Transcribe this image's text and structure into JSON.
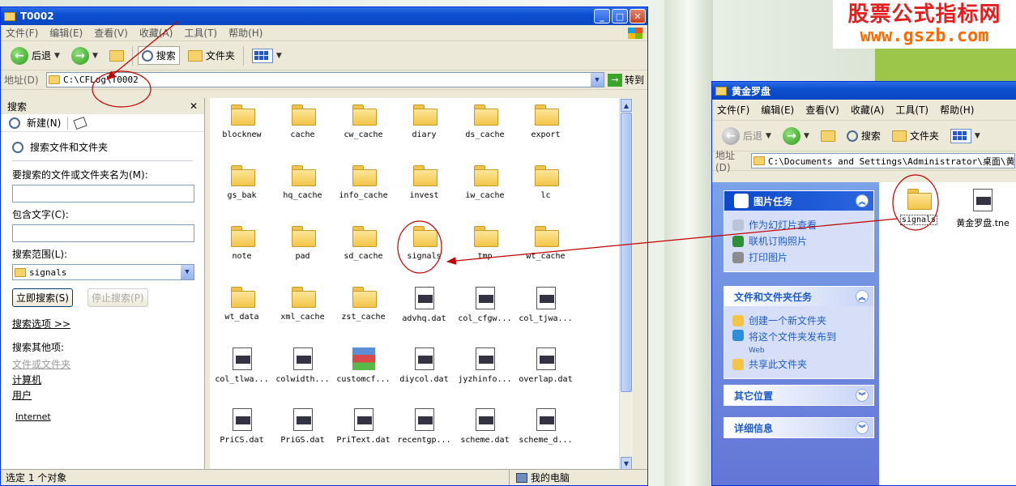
{
  "colors": {
    "title_blue": "#0c4fd0",
    "task_blue": "#6375d6",
    "annotation_red": "#c00000",
    "brand_red": "#e02020",
    "brand_orange": "#ff6a00"
  },
  "brand": {
    "line1": "股票公式指标网",
    "line2": "www.gszb.com"
  },
  "w1": {
    "title": "T0002",
    "menu": [
      "文件(F)",
      "编辑(E)",
      "查看(V)",
      "收藏(A)",
      "工具(T)",
      "帮助(H)"
    ],
    "toolbar": {
      "back": "后退",
      "search": "搜索",
      "folders": "文件夹"
    },
    "address": {
      "label": "地址(D)",
      "value": "C:\\CFLog\\T0002",
      "go": "转到"
    },
    "search_pane": {
      "title": "搜索",
      "new": "新建(N)",
      "heading": "搜索文件和文件夹",
      "name_label": "要搜索的文件或文件夹名为(M):",
      "contains_label": "包含文字(C):",
      "scope_label": "搜索范围(L):",
      "scope_value": "signals",
      "start": "立即搜索(S)",
      "stop": "停止搜索(P)",
      "options": "搜索选项 >>",
      "other": "搜索其他项:",
      "other_items": [
        "文件或文件夹",
        "计算机",
        "用户"
      ],
      "internet": "Internet"
    },
    "items": [
      {
        "name": "blocknew",
        "type": "folder"
      },
      {
        "name": "cache",
        "type": "folder"
      },
      {
        "name": "cw_cache",
        "type": "folder"
      },
      {
        "name": "diary",
        "type": "folder"
      },
      {
        "name": "ds_cache",
        "type": "folder"
      },
      {
        "name": "export",
        "type": "folder"
      },
      {
        "name": "gs_bak",
        "type": "folder"
      },
      {
        "name": "hq_cache",
        "type": "folder"
      },
      {
        "name": "info_cache",
        "type": "folder"
      },
      {
        "name": "invest",
        "type": "folder"
      },
      {
        "name": "iw_cache",
        "type": "folder"
      },
      {
        "name": "lc",
        "type": "folder"
      },
      {
        "name": "note",
        "type": "folder"
      },
      {
        "name": "pad",
        "type": "folder"
      },
      {
        "name": "sd_cache",
        "type": "folder"
      },
      {
        "name": "signals",
        "type": "folder"
      },
      {
        "name": "tmp",
        "type": "folder"
      },
      {
        "name": "wt_cache",
        "type": "folder"
      },
      {
        "name": "wt_data",
        "type": "folder"
      },
      {
        "name": "xml_cache",
        "type": "folder"
      },
      {
        "name": "zst_cache",
        "type": "folder"
      },
      {
        "name": "advhq.dat",
        "type": "doc"
      },
      {
        "name": "col_cfgw...",
        "type": "doc"
      },
      {
        "name": "col_tjwa...",
        "type": "doc"
      },
      {
        "name": "col_tlwa...",
        "type": "doc"
      },
      {
        "name": "colwidth...",
        "type": "doc"
      },
      {
        "name": "customcf...",
        "type": "rar"
      },
      {
        "name": "diycol.dat",
        "type": "doc"
      },
      {
        "name": "jyzhinfo...",
        "type": "doc"
      },
      {
        "name": "overlap.dat",
        "type": "doc"
      },
      {
        "name": "PriCS.dat",
        "type": "doc"
      },
      {
        "name": "PriGS.dat",
        "type": "doc"
      },
      {
        "name": "PriText.dat",
        "type": "doc"
      },
      {
        "name": "recentgp...",
        "type": "doc"
      },
      {
        "name": "scheme.dat",
        "type": "doc"
      },
      {
        "name": "scheme_d...",
        "type": "doc"
      }
    ],
    "status": {
      "left": "选定 1 个对象",
      "right": "我的电脑"
    }
  },
  "w2": {
    "title": "黄金罗盘",
    "menu": [
      "文件(F)",
      "编辑(E)",
      "查看(V)",
      "收藏(A)",
      "工具(T)",
      "帮助(H)"
    ],
    "toolbar": {
      "back": "后退",
      "search": "搜索",
      "folders": "文件夹"
    },
    "address": {
      "label": "地址(D)",
      "value": "C:\\Documents and Settings\\Administrator\\桌面\\黄金罗"
    },
    "picture_tasks": {
      "title": "图片任务",
      "items": [
        "作为幻灯片查看",
        "联机订购照片",
        "打印图片"
      ]
    },
    "file_tasks": {
      "title": "文件和文件夹任务",
      "items": [
        "创建一个新文件夹",
        "将这个文件夹发布到",
        "共享此文件夹"
      ],
      "web": "Web"
    },
    "other_places": "其它位置",
    "details": "详细信息",
    "files": [
      {
        "name": "signals",
        "type": "folder"
      },
      {
        "name": "黄金罗盘.tne",
        "type": "doc"
      }
    ]
  }
}
